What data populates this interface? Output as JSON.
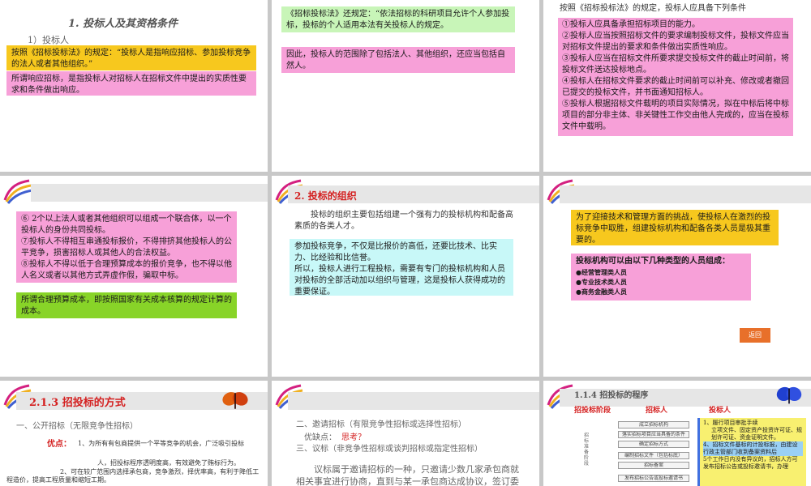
{
  "slide1": {
    "title": "1. 投标人及其资格条件",
    "subtitle": "1）投标人",
    "yellow_box": "按照《招标投标法》的规定：“投标人是指响应招标、参加投标竞争的法人或者其他组织。”",
    "pink_box": "所谓响应招标，是指投标人对招标人在招标文件中提出的实质性要求和条件做出响应。"
  },
  "slide2": {
    "green_box": "《招标投标法》还规定：“依法招标的科研项目允许个人参加投标，投标的个人适用本法有关投标人的规定。",
    "pink_box": "因此，投标人的范围除了包括法人、其他组织，还应当包括自然人。"
  },
  "slide3": {
    "heading": "按照《招标投标法》的规定，投标人应具备下列条件",
    "items": [
      "①投标人应具备承担招标项目的能力。",
      "②投标人应当按照招标文件的要求编制投标文件，投标文件应当对招标文件提出的要求和条件做出实质性响应。",
      "③投标人应当在招标文件所要求提交投标文件的截止时间前，将投标文件送达投标地点。",
      "④投标人在招标文件要求的截止时间前可以补充、修改或者撤回已提交的投标文件，并书面通知招标人。",
      "⑤投标人根据招标文件载明的项目实际情况，拟在中标后将中标项目的部分非主体、非关键性工作交由他人完成的，应当在投标文件中载明。"
    ]
  },
  "slide4": {
    "items": [
      "⑥ 2个以上法人或者其他组织可以组成一个联合体，以一个投标人的身份共同投标。",
      "⑦投标人不得相互串通投标报价，不得排挤其他投标人的公平竞争，损害招标人或其他人的合法权益。",
      "⑧投标人不得以低于合理预算成本的报价竞争，也不得以他人名义或者以其他方式弄虚作假，骗取中标。"
    ],
    "lime_box": "所谓合理预算成本，即按照国家有关成本核算的规定计算的成本。"
  },
  "slide5": {
    "title": "2. 投标的组织",
    "intro": "投标的组织主要包括组建一个强有力的投标机构和配备高素质的各类人才。",
    "cyan_box_1": "参加投标竞争，不仅是比报价的高低，还要比技术、比实力、比经验和比信誉。",
    "cyan_box_2": "所以，投标人进行工程投标，需要有专门的投标机构和人员对投标的全部活动加以组织与管理，这是投标人获得成功的重要保证。"
  },
  "slide6": {
    "yellow_box": "为了迎接技术和管理方面的挑战，使投标人在激烈的投标竞争中取胜，组建投标机构和配备各类人员是极其重要的。",
    "pink_heading": "投标机构可以由以下几种类型的人员组成：",
    "pink_items": [
      "●经营管理类人员",
      "●专业技术类人员",
      "●商务金融类人员"
    ],
    "button_label": "返回"
  },
  "slide7": {
    "title": "2.1.3  招投标的方式",
    "section": "一、公开招标（无限竞争性招标）",
    "pros_label": "优点：",
    "pros_1": "1、为所有有包商提供一个平等竞争的机会，广泛吸引投标",
    "pros_1b": "人，招投标程序透明度高，有效避免了贿标行为。",
    "pros_2": "2、可在较广范围内选择承包商，竞争激烈，择优率高，有利于降低工程造价，提高工程质量和缩短工期。"
  },
  "slide8": {
    "section_1": "二、邀请招标（有限竞争性招标或选择性招标）",
    "pros_cons_label": "优缺点：",
    "pros_cons_value": "思考？",
    "section_2": "三、议标（非竞争性招标或谈判招标或指定性招标）",
    "body": "议标属于邀请招标的一种，只邀请少数几家承包商就相关事宜进行协商，直到与某一承包商达成协议，签订委"
  },
  "slide9": {
    "title": "1.1.4 招投标的程序",
    "col_1": "招投标阶段",
    "col_2": "招标人",
    "col_3": "投标人",
    "phase_label": "招标准备阶段",
    "flow": [
      "成立招标机构",
      "落实招标项目应当具备的条件",
      "确定招标方式",
      "编制招标文件（包括标底）",
      "招标备案",
      "发布招标公告或投标邀请书"
    ],
    "note_1": "1、履行项目审批手续",
    "note_1b": "立项文件、固定资产投资许可证、规划许可证、资金证明文件。",
    "note_2": "4、招标文件基标的计投标报，由建设行政主管部门收到备案资料后",
    "note_3": "5个工作日内没有异议的，招标人方可发布招标公告或投标邀请书，办理"
  }
}
